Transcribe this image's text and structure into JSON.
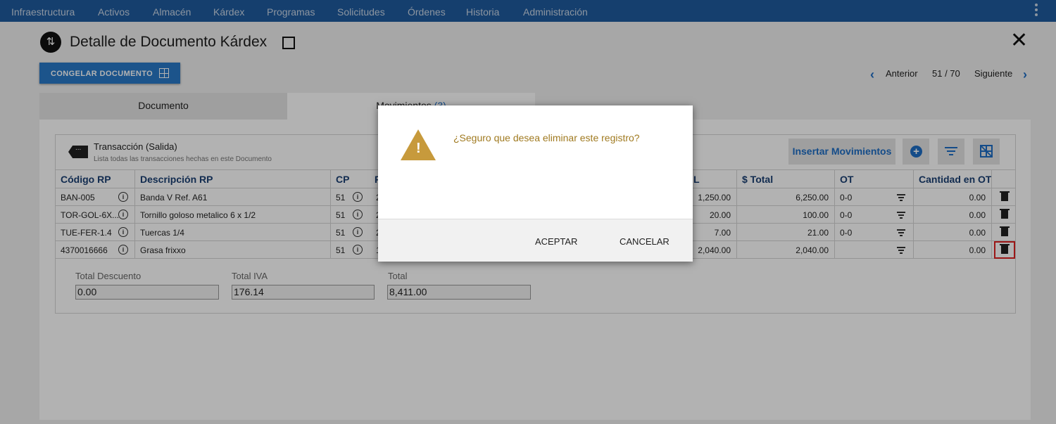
{
  "nav": {
    "items": [
      "Infraestructura",
      "Activos",
      "Almacén",
      "Kárdex",
      "Programas",
      "Solicitudes",
      "Órdenes",
      "Historia",
      "Administración"
    ]
  },
  "header": {
    "title": "Detalle de Documento Kárdex",
    "doc_icon": "swap-vertical-icon",
    "close_glyph": "✕"
  },
  "toolbar": {
    "freeze_label": "CONGELAR DOCUMENTO"
  },
  "pager": {
    "prev_label": "Anterior",
    "position": "51 / 70",
    "next_label": "Siguiente"
  },
  "tabs": {
    "documento": "Documento",
    "movimientos": "Movimientos",
    "movimientos_count": "(3)"
  },
  "card": {
    "title": "Transacción (Salida)",
    "subtitle": "Lista todas las transacciones hechas en este Documento",
    "insert_label": "Insertar Movimientos"
  },
  "table": {
    "headers": {
      "codigo": "Código RP",
      "descripcion": "Descripción RP",
      "cp": "CP",
      "col4": "F",
      "total_unit": "L",
      "total": "$ Total",
      "ot": "OT",
      "cantidad_ot": "Cantidad en OT"
    },
    "rows": [
      {
        "codigo": "BAN-005",
        "descripcion": "Banda V Ref. A61",
        "cp": "51",
        "col4": "2",
        "unit": "1,250.00",
        "total": "6,250.00",
        "ot": "0-0",
        "cantidad_ot": "0.00"
      },
      {
        "codigo": "TOR-GOL-6X...",
        "descripcion": "Tornillo goloso metalico 6 x 1/2",
        "cp": "51",
        "col4": "2",
        "unit": "20.00",
        "total": "100.00",
        "ot": "0-0",
        "cantidad_ot": "0.00"
      },
      {
        "codigo": "TUE-FER-1.4",
        "descripcion": "Tuercas 1/4",
        "cp": "51",
        "col4": "2",
        "unit": "7.00",
        "total": "21.00",
        "ot": "0-0",
        "cantidad_ot": "0.00"
      },
      {
        "codigo": "4370016666",
        "descripcion": "Grasa frixxo",
        "cp": "51",
        "col4": "1",
        "unit": "2,040.00",
        "total": "2,040.00",
        "ot": "",
        "cantidad_ot": "0.00"
      }
    ]
  },
  "totals": {
    "descuento_label": "Total Descuento",
    "descuento_value": "0.00",
    "iva_label": "Total IVA",
    "iva_value": "176.14",
    "total_label": "Total",
    "total_value": "8,411.00"
  },
  "modal": {
    "icon": "warning-icon",
    "message": "¿Seguro que desea eliminar este registro?",
    "accept_label": "ACEPTAR",
    "cancel_label": "CANCELAR"
  },
  "colors": {
    "nav": "#1f5b9e",
    "accent": "#1e6dc4",
    "warning": "#c79a3c",
    "highlight": "#e02020"
  }
}
